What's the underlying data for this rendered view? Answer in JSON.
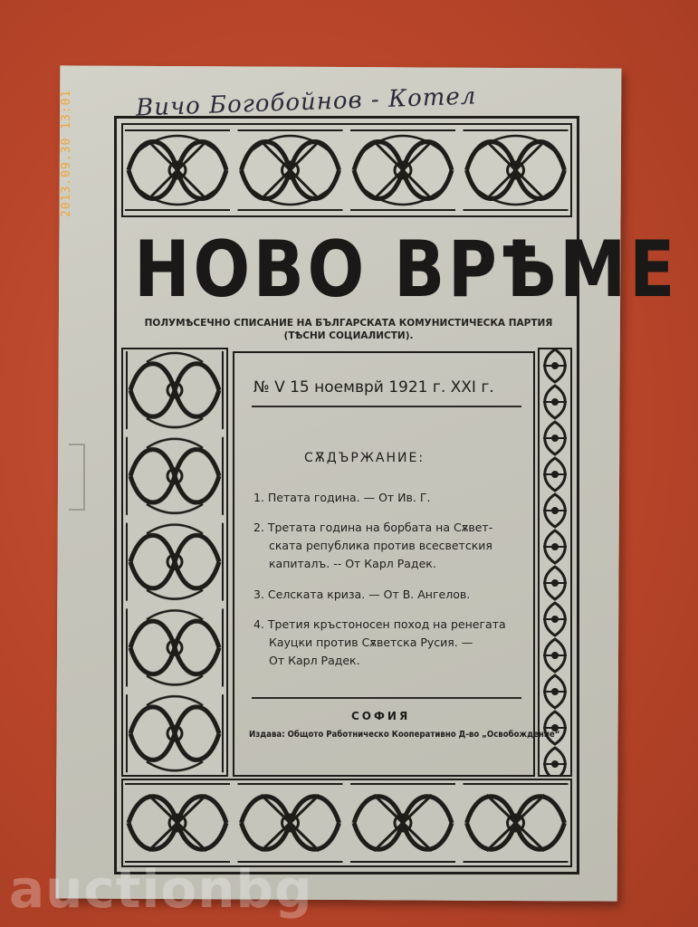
{
  "camera_timestamp": "2013.09.30 13:01",
  "watermark_text": "auctionbg",
  "handwritten_note": "Вичо Богобойнов - Котел",
  "magazine": {
    "title": "НОВО ВРѢМЕ",
    "subtitle_line1": "ПОЛУМѢСЕЧНО СПИСАНИЕ НА БЪЛГАРСКАТА КОМУНИСТИЧЕСКА ПАРТИЯ",
    "subtitle_line2": "(ТѢСНИ СОЦИАЛИСТИ).",
    "issue_line": "№ V  15 ноемврй 1921 г.  XXI г.",
    "contents_heading": "СѪДЪРЖАНИЕ:",
    "toc": [
      {
        "line1": "1. Петата година. — От Ив. Г."
      },
      {
        "line1": "2. Третата година на борбата на Сѫвет-",
        "line2": "ската република против всесветския",
        "line3": "капиталъ. -- От Карл Радек."
      },
      {
        "line1": "3. Селската криза. — От В. Ангелов."
      },
      {
        "line1": "4. Третия кръстоносен поход на ренегата",
        "line2": "Кауцки против Сѫветска Русия. —",
        "line3": "От Карл Радек."
      }
    ],
    "city": "СОФИЯ",
    "publisher": "Издава: Общото Работническо Кооперативно Д-во „Освобождение“"
  },
  "colors": {
    "background": "#b9472c",
    "paper": "#c8c7bd",
    "ink": "#1e1d1a",
    "timestamp": "#f2a12e"
  }
}
